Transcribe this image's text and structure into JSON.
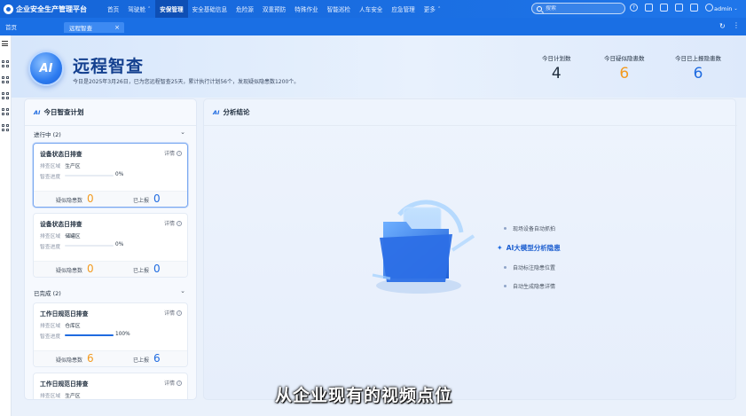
{
  "app": {
    "title": "企业安全生产管理平台"
  },
  "nav": [
    {
      "label": "首页",
      "caret": false,
      "active": false
    },
    {
      "label": "驾驶舱",
      "caret": true,
      "active": false
    },
    {
      "label": "安保管理",
      "caret": false,
      "active": true
    },
    {
      "label": "安全基础信息",
      "caret": false,
      "active": false
    },
    {
      "label": "危险源",
      "caret": false,
      "active": false
    },
    {
      "label": "双重预防",
      "caret": false,
      "active": false
    },
    {
      "label": "特殊作业",
      "caret": false,
      "active": false
    },
    {
      "label": "智能巡检",
      "caret": false,
      "active": false
    },
    {
      "label": "人车安全",
      "caret": false,
      "active": false
    },
    {
      "label": "应急管理",
      "caret": false,
      "active": false
    },
    {
      "label": "更多",
      "caret": true,
      "active": false
    }
  ],
  "search": {
    "placeholder": "搜索"
  },
  "user": {
    "name": "admin"
  },
  "tabs": {
    "home": "首页",
    "active": "远程智查",
    "close": "×"
  },
  "header": {
    "badge": "AI",
    "title": "远程智查",
    "summary": "今日是2025年3月26日，已为您远程智查25天，累计执行计划56个，发现疑似隐患数1200个。",
    "stats": [
      {
        "label": "今日计划数",
        "value": "4",
        "color": "#1f2d3d"
      },
      {
        "label": "今日疑似隐患数",
        "value": "6",
        "color": "#f39a1e"
      },
      {
        "label": "今日已上报隐患数",
        "value": "6",
        "color": "#1f6be0"
      }
    ]
  },
  "plan_panel": {
    "title": "今日智查计划",
    "ai": "AI",
    "running": {
      "label": "进行中 (2)"
    },
    "done": {
      "label": "已完成 (2)"
    },
    "detail_label": "详情",
    "area_label": "排查区域",
    "progress_label": "智查进度",
    "suspected_label": "疑似隐患数",
    "reported_label": "已上报",
    "cards": [
      {
        "title": "设备状态日排查",
        "area": "生产区",
        "progress": 0,
        "progress_text": "0%",
        "suspected": "0",
        "reported": "0"
      },
      {
        "title": "设备状态日排查",
        "area": "储罐区",
        "progress": 0,
        "progress_text": "0%",
        "suspected": "0",
        "reported": "0"
      },
      {
        "title": "工作日规范日排查",
        "area": "仓库区",
        "progress": 1.0,
        "progress_text": "100%",
        "suspected": "6",
        "reported": "6"
      },
      {
        "title": "工作日规范日排查",
        "area": "生产区"
      }
    ]
  },
  "result_panel": {
    "title": "分析结论",
    "ai": "AI",
    "features": [
      {
        "text": "现场设备自动抓拍",
        "main": false
      },
      {
        "text": "AI大模型分析隐患",
        "main": true
      },
      {
        "text": "自动标注隐患位置",
        "main": false
      },
      {
        "text": "自动生成隐患详情",
        "main": false
      }
    ]
  },
  "caption": "从企业现有的视频点位"
}
